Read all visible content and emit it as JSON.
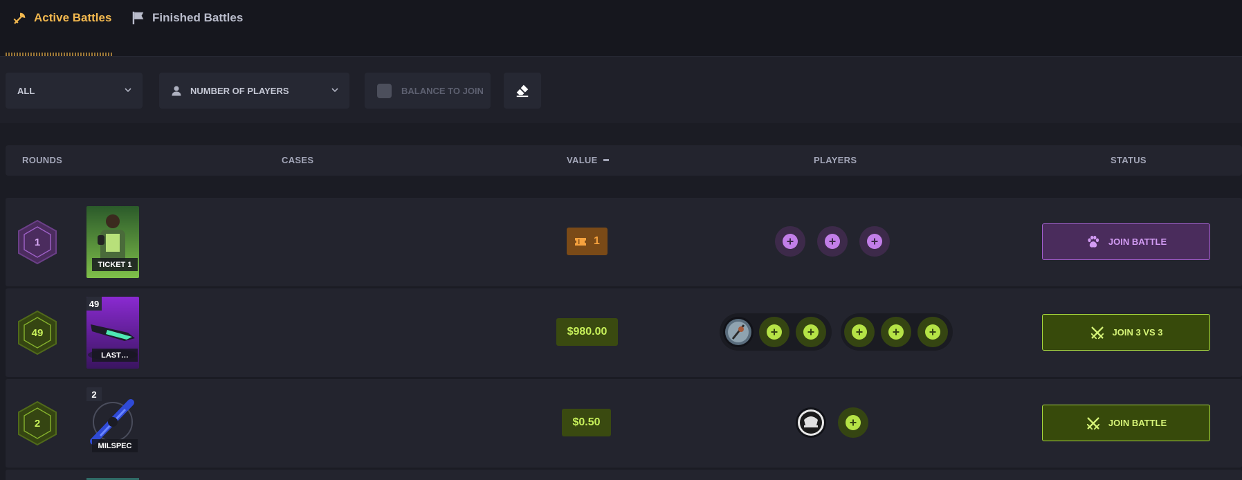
{
  "tabs": {
    "active_label": "Active Battles",
    "finished_label": "Finished Battles"
  },
  "filters": {
    "mode_value": "ALL",
    "players_value": "NUMBER OF PLAYERS",
    "balance_label": "BALANCE TO JOIN",
    "balance_checked": false
  },
  "table": {
    "headers": {
      "rounds": "ROUNDS",
      "cases": "CASES",
      "value": "VALUE",
      "players": "PLAYERS",
      "status": "STATUS"
    }
  },
  "rows": [
    {
      "rounds": "1",
      "case_name": "TICKET 1",
      "case_qty": "",
      "value": "1",
      "value_icon": "ticket-icon",
      "status_label": "JOIN BATTLE",
      "status_icon": "paw-icon",
      "theme": "#c27ee8"
    },
    {
      "rounds": "49",
      "case_name": "LAST…",
      "case_qty": "49",
      "value": "$980.00",
      "status_label": "JOIN 3 VS 3",
      "status_icon": "crossed-swords-icon",
      "theme": "#b5e346"
    },
    {
      "rounds": "2",
      "case_name": "MILSPEC",
      "case_qty": "2",
      "value": "$0.50",
      "status_label": "JOIN BATTLE",
      "status_icon": "crossed-swords-icon",
      "theme": "#b5e346"
    }
  ],
  "colors": {
    "accent_gold": "#f2b84f",
    "purple": "#c27ee8",
    "green": "#b5e346",
    "background": "#1b1c24"
  }
}
